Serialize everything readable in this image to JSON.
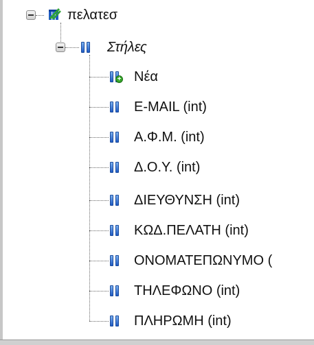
{
  "tree": {
    "table": {
      "label": "πελατεσ",
      "icon": "table-icon",
      "expanded": true
    },
    "columns_folder": {
      "label": "Στήλες",
      "icon": "columns-icon",
      "expanded": true
    },
    "new_item": {
      "label": "Νέα",
      "icon": "add-column-icon"
    },
    "columns": [
      {
        "label": "E-MAIL (int)",
        "icon": "column-icon"
      },
      {
        "label": "Α.Φ.Μ. (int)",
        "icon": "column-icon"
      },
      {
        "label": "Δ.Ο.Υ. (int)",
        "icon": "column-icon"
      },
      {
        "label": "ΔΙΕΥΘΥΝΣΗ (int)",
        "icon": "column-icon"
      },
      {
        "label": "ΚΩΔ.ΠΕΛΑΤΗ (int)",
        "icon": "column-icon"
      },
      {
        "label": "ΟΝΟΜΑΤΕΠΩΝΥΜΟ (",
        "icon": "column-icon"
      },
      {
        "label": "ΤΗΛΕΦΩΝΟ (int)",
        "icon": "column-icon"
      },
      {
        "label": "ΠΛΗΡΩΜΗ (int)",
        "icon": "column-icon"
      }
    ]
  }
}
